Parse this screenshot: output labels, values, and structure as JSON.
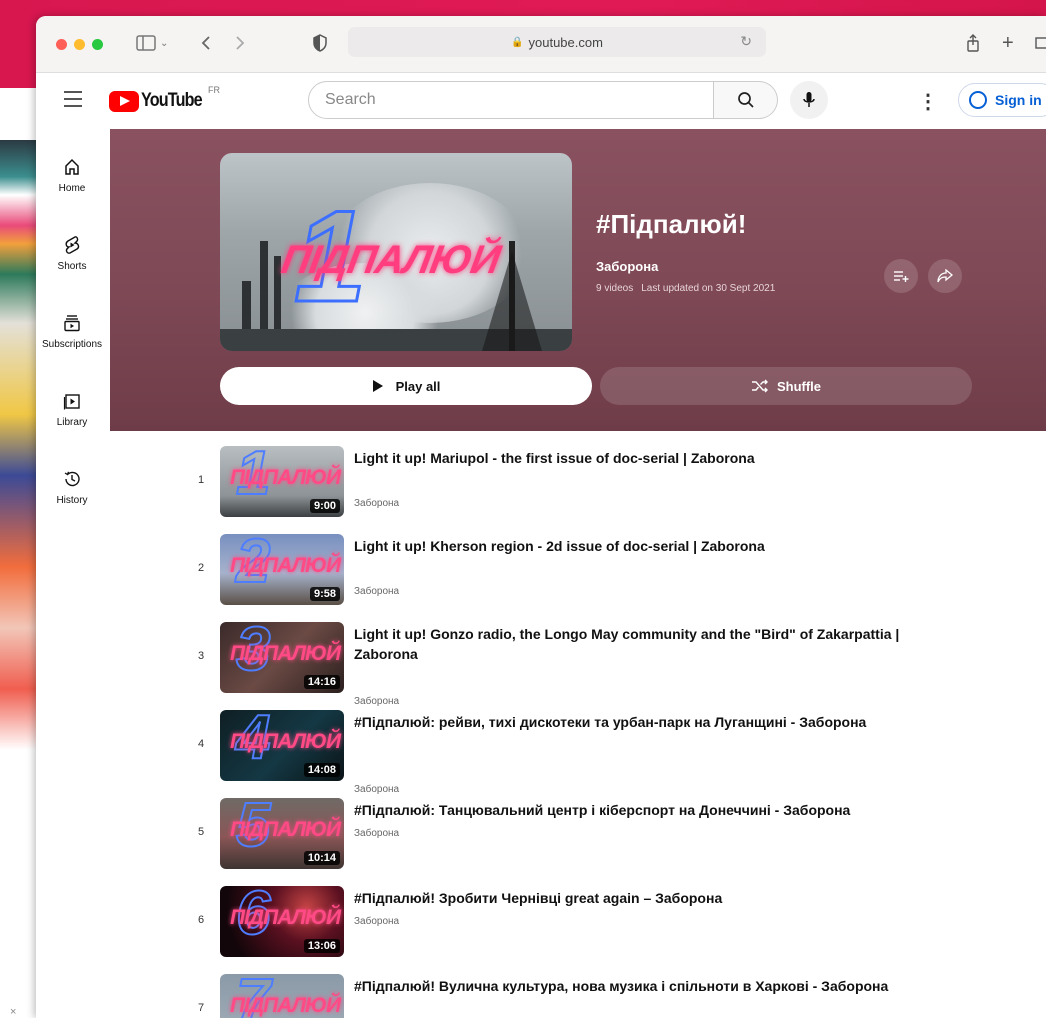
{
  "browser": {
    "url": "youtube.com"
  },
  "header": {
    "logo_text": "YouTube",
    "country_code": "FR",
    "search_placeholder": "Search",
    "sign_in_label": "Sign in"
  },
  "sidebar": {
    "items": [
      {
        "label": "Home"
      },
      {
        "label": "Shorts"
      },
      {
        "label": "Subscriptions"
      },
      {
        "label": "Library"
      },
      {
        "label": "History"
      }
    ]
  },
  "playlist": {
    "title": "#Підпалюй!",
    "channel": "Заборона",
    "video_count": "9 videos",
    "last_updated": "Last updated on 30 Sept 2021",
    "play_all_label": "Play all",
    "shuffle_label": "Shuffle",
    "thumbnail_numeral": "1",
    "thumbnail_word": "ПІДПАЛЮЙ"
  },
  "videos": [
    {
      "index": "1",
      "title": "Light it up! Mariupol - the first issue of doc-serial | Zaborona",
      "channel": "Заборона",
      "duration": "9:00",
      "thumb_numeral": "1"
    },
    {
      "index": "2",
      "title": "Light it up! Kherson region - 2d issue of doc-serial | Zaborona",
      "channel": "Заборона",
      "duration": "9:58",
      "thumb_numeral": "2"
    },
    {
      "index": "3",
      "title": "Light it up! Gonzo radio, the Longo May community and the \"Bird\" of Zakarpattia | Zaborona",
      "channel": "Заборона",
      "duration": "14:16",
      "thumb_numeral": "3"
    },
    {
      "index": "4",
      "title": "#Підпалюй: рейви, тихі дискотеки та урбан-парк на Луганщині - Заборона",
      "channel": "Заборона",
      "duration": "14:08",
      "thumb_numeral": "4"
    },
    {
      "index": "5",
      "title": "#Підпалюй: Танцювальний центр і кіберспорт на Донеччині - Заборона",
      "channel": "Заборона",
      "duration": "10:14",
      "thumb_numeral": "5"
    },
    {
      "index": "6",
      "title": "#Підпалюй! Зробити Чернівці great again – Заборона",
      "channel": "Заборона",
      "duration": "13:06",
      "thumb_numeral": "6"
    },
    {
      "index": "7",
      "title": "#Підпалюй! Вулична культура, нова музика і спільноти в Харкові - Заборона",
      "channel": "Заборона",
      "duration": "",
      "thumb_numeral": "7"
    }
  ],
  "colors": {
    "background": "#d8174f",
    "hero": "#7e4855",
    "youtube_red": "#ff0000",
    "link_blue": "#065fd4"
  }
}
